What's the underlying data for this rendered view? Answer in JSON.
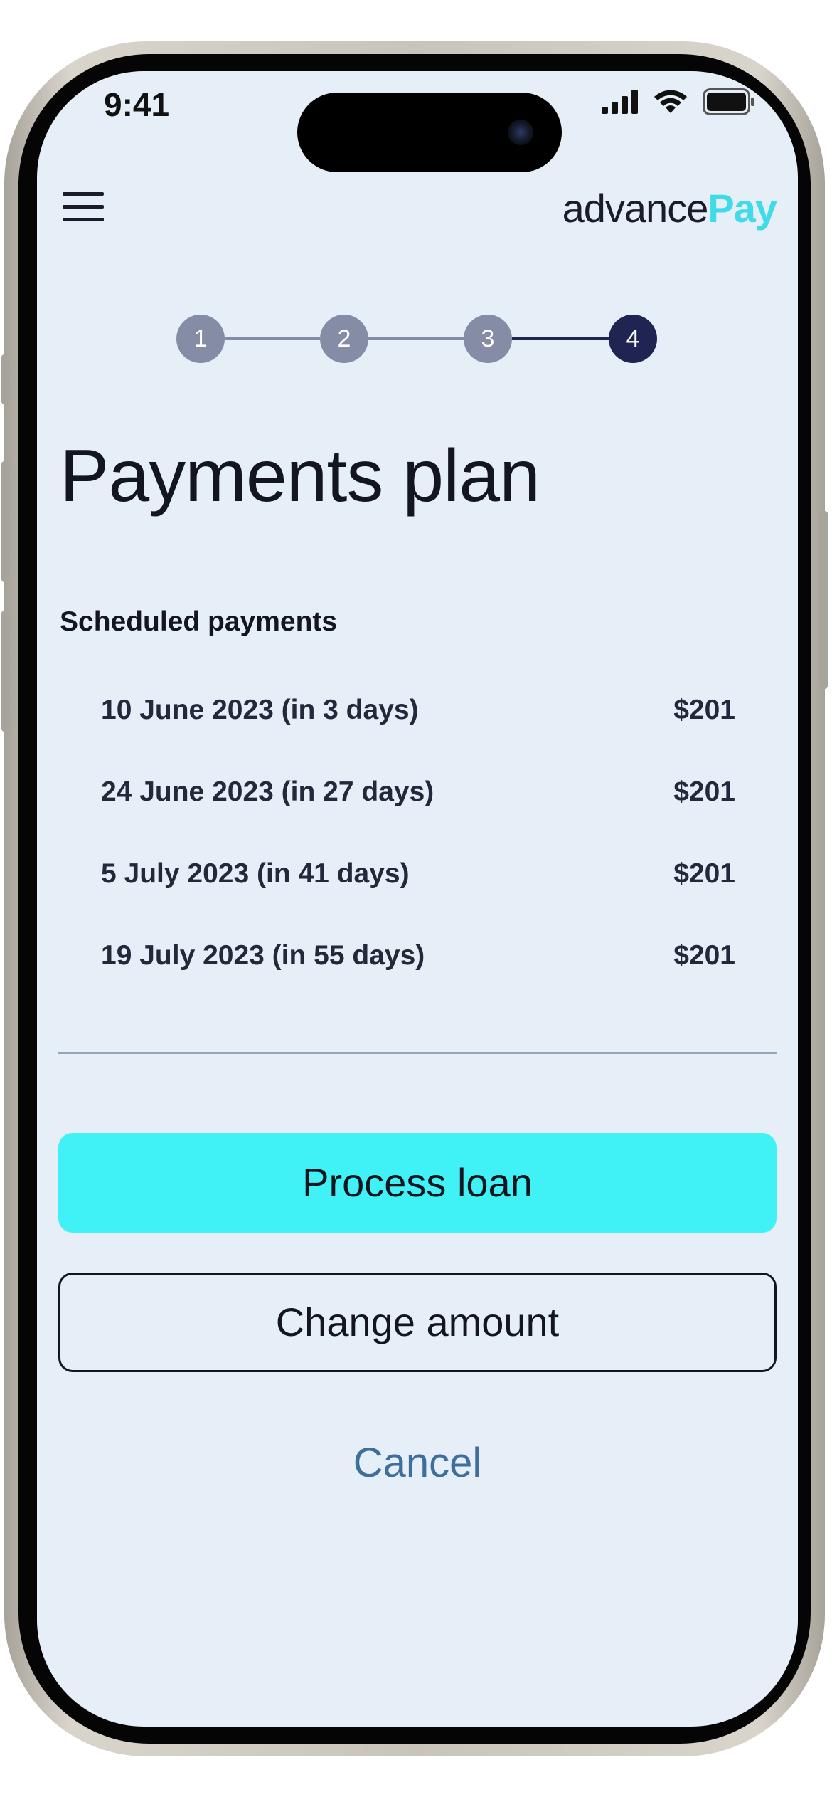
{
  "status_bar": {
    "time": "9:41"
  },
  "header": {
    "menu_icon": "hamburger-menu-icon",
    "logo_light": "advance",
    "logo_bold": "Pay"
  },
  "stepper": {
    "steps": [
      "1",
      "2",
      "3",
      "4"
    ],
    "current_step": 4
  },
  "main": {
    "title": "Payments plan",
    "section_label": "Scheduled payments",
    "payments": [
      {
        "date": "10 June 2023 (in 3 days)",
        "amount": "$201"
      },
      {
        "date": "24 June 2023 (in 27 days)",
        "amount": "$201"
      },
      {
        "date": "5 July 2023 (in 41 days)",
        "amount": "$201"
      },
      {
        "date": "19 July 2023 (in 55 days)",
        "amount": "$201"
      }
    ]
  },
  "actions": {
    "primary_label": "Process loan",
    "secondary_label": "Change amount",
    "cancel_label": "Cancel"
  },
  "colors": {
    "accent": "#40f2f5",
    "logo_accent": "#3fdbe8",
    "step_inactive": "#858ca6",
    "step_active": "#1f2452",
    "background": "#e6eef7",
    "link": "#3d6e9c"
  }
}
